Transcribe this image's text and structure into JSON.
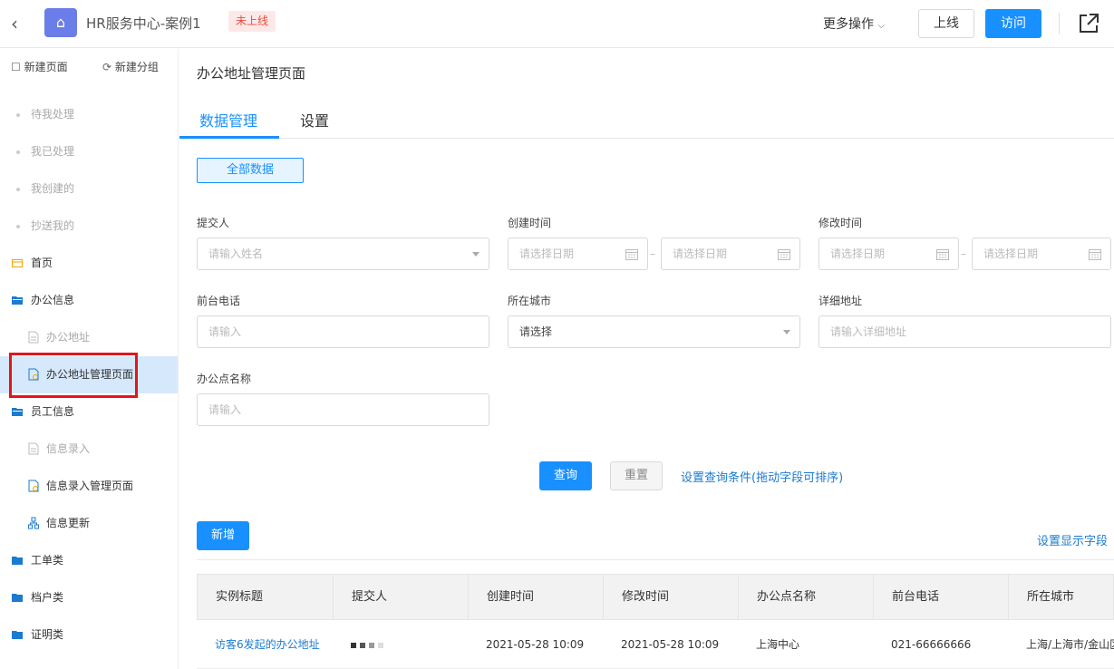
{
  "header": {
    "back_icon": "chevron-left-icon",
    "app_title": "HR服务中心-案例1",
    "status_badge": "未上线",
    "more_actions": "更多操作",
    "online_button": "上线",
    "visit_button": "访问",
    "accent": "#1890ff"
  },
  "sidebar": {
    "new_page": "新建页面",
    "new_group": "新建分组",
    "items": [
      {
        "label": "待我处理",
        "type": "dot"
      },
      {
        "label": "我已处理",
        "type": "dot"
      },
      {
        "label": "我创建的",
        "type": "dot"
      },
      {
        "label": "抄送我的",
        "type": "dot"
      },
      {
        "label": "首页",
        "type": "home"
      },
      {
        "label": "办公信息",
        "type": "folder"
      },
      {
        "label": "办公地址",
        "type": "page"
      },
      {
        "label": "办公地址管理页面",
        "type": "manage-page",
        "active": true
      },
      {
        "label": "员工信息",
        "type": "folder"
      },
      {
        "label": "信息录入",
        "type": "page"
      },
      {
        "label": "信息录入管理页面",
        "type": "manage-page"
      },
      {
        "label": "信息更新",
        "type": "flow"
      },
      {
        "label": "工单类",
        "type": "folder-closed"
      },
      {
        "label": "档户类",
        "type": "folder-closed"
      },
      {
        "label": "证明类",
        "type": "folder-closed"
      }
    ]
  },
  "main": {
    "page_title": "办公地址管理页面",
    "tabs": [
      "数据管理",
      "设置"
    ],
    "all_data_button": "全部数据",
    "filters": {
      "submitter": {
        "label": "提交人",
        "placeholder": "请输入姓名"
      },
      "created_time": {
        "label": "创建时间",
        "start": "请选择日期",
        "end": "请选择日期"
      },
      "modified_time": {
        "label": "修改时间",
        "start": "请选择日期",
        "end": "请选择日期"
      },
      "front_phone": {
        "label": "前台电话",
        "placeholder": "请输入"
      },
      "city": {
        "label": "所在城市",
        "value": "请选择"
      },
      "address": {
        "label": "详细地址",
        "placeholder": "请输入详细地址"
      },
      "office_name": {
        "label": "办公点名称",
        "placeholder": "请输入"
      }
    },
    "query_button": "查询",
    "reset_button": "重置",
    "set_conditions_link": "设置查询条件(拖动字段可排序)",
    "add_button": "新增",
    "set_fields_link": "设置显示字段",
    "table": {
      "columns": [
        "实例标题",
        "提交人",
        "创建时间",
        "修改时间",
        "办公点名称",
        "前台电话",
        "所在城市"
      ],
      "rows": [
        {
          "title": "访客6发起的办公地址",
          "submitter": "",
          "created": "2021-05-28 10:09",
          "modified": "2021-05-28 10:09",
          "office": "上海中心",
          "phone": "021-66666666",
          "city": "上海/上海市/金山区"
        }
      ]
    }
  }
}
